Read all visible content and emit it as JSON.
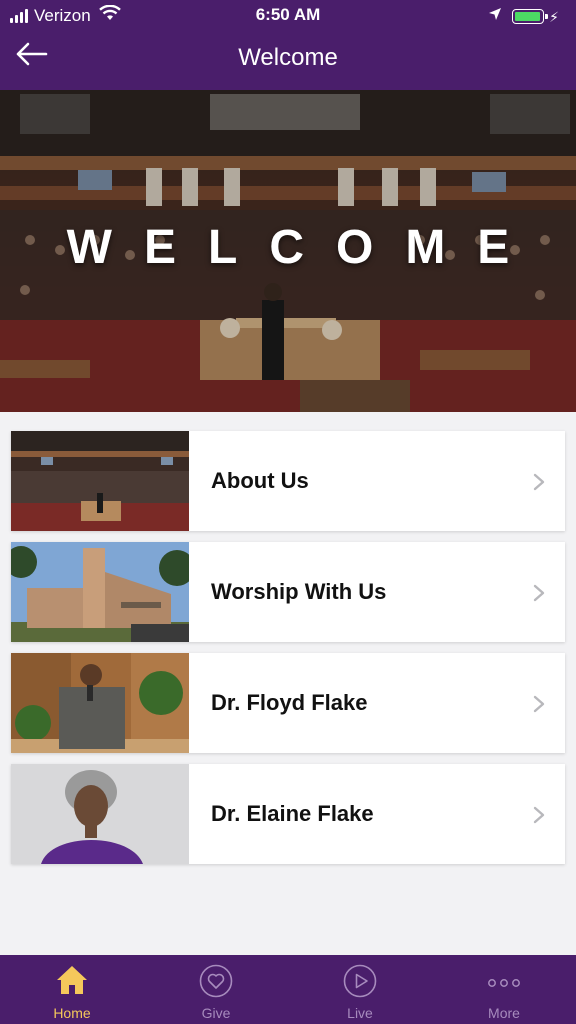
{
  "status_bar": {
    "carrier": "Verizon",
    "time": "6:50 AM",
    "battery_color": "#4cd964"
  },
  "nav": {
    "title": "Welcome",
    "back_icon": "arrow-left-icon"
  },
  "hero": {
    "text": "WELCOME"
  },
  "menu": [
    {
      "label": "About Us",
      "icon": "chevron-right-icon"
    },
    {
      "label": "Worship With Us",
      "icon": "chevron-right-icon"
    },
    {
      "label": "Dr. Floyd Flake",
      "icon": "chevron-right-icon"
    },
    {
      "label": "Dr. Elaine Flake",
      "icon": "chevron-right-icon"
    }
  ],
  "tabs": [
    {
      "label": "Home",
      "icon": "home-icon",
      "active": true
    },
    {
      "label": "Give",
      "icon": "heart-icon",
      "active": false
    },
    {
      "label": "Live",
      "icon": "play-icon",
      "active": false
    },
    {
      "label": "More",
      "icon": "more-icon",
      "active": false
    }
  ],
  "colors": {
    "brand_purple": "#4a1e6b",
    "active_tab": "#f5c85b",
    "inactive_tab": "#a78bbd"
  }
}
